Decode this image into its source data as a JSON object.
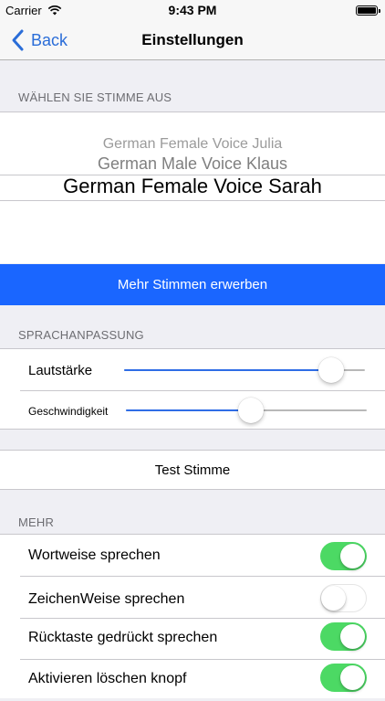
{
  "status_bar": {
    "carrier": "Carrier",
    "time": "9:43 PM"
  },
  "nav": {
    "back_label": "Back",
    "title": "Einstellungen"
  },
  "voice_section": {
    "header": "WÄHLEN SIE STIMME AUS",
    "options": [
      "German Female Voice Julia",
      "German Male Voice Klaus",
      "German Female Voice Sarah"
    ],
    "selected": "German Female Voice Sarah"
  },
  "buy_button_label": "Mehr Stimmen erwerben",
  "speech_section": {
    "header": "SPRACHANPASSUNG",
    "volume": {
      "label": "Lautstärke",
      "value": 0.86
    },
    "speed": {
      "label": "Geschwindigkeit",
      "value": 0.52
    }
  },
  "test_button_label": "Test Stimme",
  "more_section": {
    "header": "MEHR",
    "toggles": [
      {
        "label": "Wortweise sprechen",
        "on": true
      },
      {
        "label": "ZeichenWeise sprechen",
        "on": false
      },
      {
        "label": "Rücktaste gedrückt sprechen",
        "on": true
      },
      {
        "label": "Aktivieren löschen knopf",
        "on": true
      }
    ]
  },
  "colors": {
    "accent": "#2a6dd8",
    "button_blue": "#1a66ff",
    "toggle_on": "#4cd964",
    "background": "#efeff4"
  }
}
